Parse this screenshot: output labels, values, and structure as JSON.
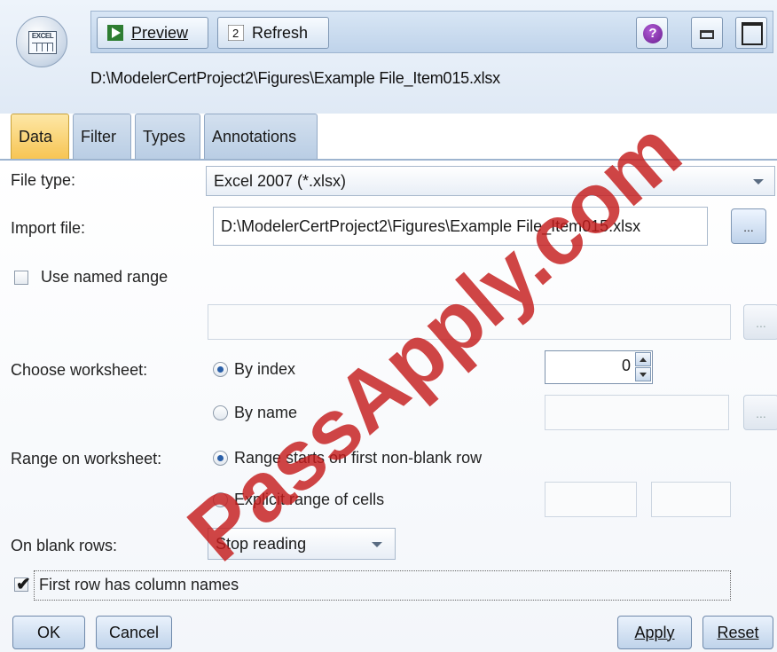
{
  "header": {
    "node_icon": "excel-icon",
    "node_icon_text": "EXCEL",
    "toolbar": {
      "preview_label": "Preview",
      "refresh_label": "Refresh",
      "help_icon": "help-icon",
      "minimize_icon": "minimize-icon",
      "maximize_icon": "maximize-icon"
    },
    "file_path": "D:\\ModelerCertProject2\\Figures\\Example File_Item015.xlsx"
  },
  "tabs": [
    {
      "label": "Data",
      "active": true
    },
    {
      "label": "Filter",
      "active": false
    },
    {
      "label": "Types",
      "active": false
    },
    {
      "label": "Annotations",
      "active": false
    }
  ],
  "form": {
    "file_type_label": "File type:",
    "file_type_value": "Excel 2007 (*.xlsx)",
    "import_file_label": "Import file:",
    "import_file_value": "D:\\ModelerCertProject2\\Figures\\Example File_Item015.xlsx",
    "browse_label": "...",
    "use_named_range_label": "Use named range",
    "use_named_range_checked": false,
    "named_range_value": "",
    "choose_worksheet_label": "Choose worksheet:",
    "by_index_label": "By index",
    "by_index_value": "0",
    "by_name_label": "By name",
    "selected_worksheet_mode": "By index",
    "range_label": "Range on worksheet:",
    "range_first_nonblank_label": "Range starts on first non-blank row",
    "range_explicit_label": "Explicit range of cells",
    "selected_range_mode": "Range starts on first non-blank row",
    "blank_rows_label": "On blank rows:",
    "blank_rows_value": "Stop reading",
    "first_row_names_label": "First row has column names",
    "first_row_names_checked": true
  },
  "footer": {
    "ok_label": "OK",
    "cancel_label": "Cancel",
    "apply_label": "Apply",
    "reset_label": "Reset"
  },
  "watermark": "PassApply.com",
  "colors": {
    "active_tab": "#f7c452",
    "watermark": "#c41c1c",
    "toolbar_bg": "#bfd3ea"
  }
}
